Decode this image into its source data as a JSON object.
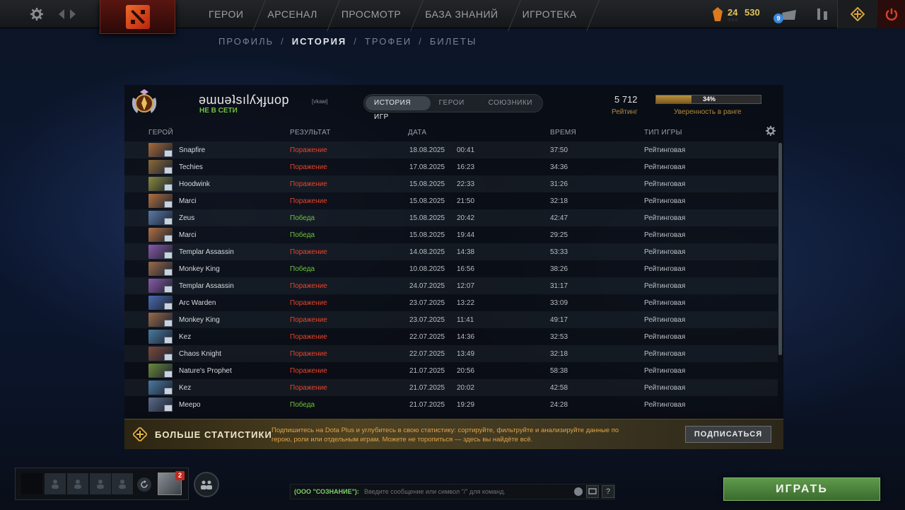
{
  "topbar": {
    "nav": [
      {
        "label": "ГЕРОИ"
      },
      {
        "label": "АРСЕНАЛ"
      },
      {
        "label": "ПРОСМОТР"
      },
      {
        "label": "БАЗА ЗНАНИЙ"
      },
      {
        "label": "ИГРОТЕКА"
      }
    ],
    "currency1": "24",
    "currency2": "530",
    "notifications": "9"
  },
  "subnav": {
    "items": [
      {
        "label": "ПРОФИЛЬ",
        "active": false
      },
      {
        "label": "ИСТОРИЯ",
        "active": true
      },
      {
        "label": "ТРОФЕИ",
        "active": false
      },
      {
        "label": "БИЛЕТЫ",
        "active": false
      }
    ]
  },
  "profile": {
    "name": "ǝɯuǝʇsılʎʞɟuop",
    "tag": "[vkaм]",
    "status": "НЕ В СЕТИ"
  },
  "tabs": [
    {
      "label": "ИСТОРИЯ ИГР",
      "active": true
    },
    {
      "label": "ГЕРОИ",
      "active": false
    },
    {
      "label": "СОЮЗНИКИ",
      "active": false
    }
  ],
  "rating": {
    "value": "5 712",
    "label": "Рейтинг",
    "confidence_percent": 34,
    "confidence_text": "34%",
    "confidence_label": "Уверенность в ранге"
  },
  "columns": {
    "hero": "ГЕРОЙ",
    "result": "РЕЗУЛЬТАТ",
    "date": "ДАТА",
    "duration": "ВРЕМЯ",
    "type": "ТИП ИГРЫ"
  },
  "matches": [
    {
      "hero": "Snapfire",
      "result": "Поражение",
      "win": false,
      "date": "18.08.2025",
      "time": "00:41",
      "duration": "37:50",
      "type": "Рейтинговая",
      "color": "#a86a38"
    },
    {
      "hero": "Techies",
      "result": "Поражение",
      "win": false,
      "date": "17.08.2025",
      "time": "16:23",
      "duration": "34:36",
      "type": "Рейтинговая",
      "color": "#8a6a3a"
    },
    {
      "hero": "Hoodwink",
      "result": "Поражение",
      "win": false,
      "date": "15.08.2025",
      "time": "22:33",
      "duration": "31:26",
      "type": "Рейтинговая",
      "color": "#8a8a3a"
    },
    {
      "hero": "Marci",
      "result": "Поражение",
      "win": false,
      "date": "15.08.2025",
      "time": "21:50",
      "duration": "32:18",
      "type": "Рейтинговая",
      "color": "#b07040"
    },
    {
      "hero": "Zeus",
      "result": "Победа",
      "win": true,
      "date": "15.08.2025",
      "time": "20:42",
      "duration": "42:47",
      "type": "Рейтинговая",
      "color": "#5a7aa8"
    },
    {
      "hero": "Marci",
      "result": "Победа",
      "win": true,
      "date": "15.08.2025",
      "time": "19:44",
      "duration": "29:25",
      "type": "Рейтинговая",
      "color": "#b07040"
    },
    {
      "hero": "Templar Assassin",
      "result": "Поражение",
      "win": false,
      "date": "14.08.2025",
      "time": "14:38",
      "duration": "53:33",
      "type": "Рейтинговая",
      "color": "#8a5aa8"
    },
    {
      "hero": "Monkey King",
      "result": "Победа",
      "win": true,
      "date": "10.08.2025",
      "time": "16:56",
      "duration": "38:26",
      "type": "Рейтинговая",
      "color": "#9a6a4a"
    },
    {
      "hero": "Templar Assassin",
      "result": "Поражение",
      "win": false,
      "date": "24.07.2025",
      "time": "12:07",
      "duration": "31:17",
      "type": "Рейтинговая",
      "color": "#8a5aa8"
    },
    {
      "hero": "Arc Warden",
      "result": "Поражение",
      "win": false,
      "date": "23.07.2025",
      "time": "13:22",
      "duration": "33:09",
      "type": "Рейтинговая",
      "color": "#4a6ab0"
    },
    {
      "hero": "Monkey King",
      "result": "Поражение",
      "win": false,
      "date": "23.07.2025",
      "time": "11:41",
      "duration": "49:17",
      "type": "Рейтинговая",
      "color": "#9a6a4a"
    },
    {
      "hero": "Kez",
      "result": "Поражение",
      "win": false,
      "date": "22.07.2025",
      "time": "14:36",
      "duration": "32:53",
      "type": "Рейтинговая",
      "color": "#4a7aa0"
    },
    {
      "hero": "Chaos Knight",
      "result": "Поражение",
      "win": false,
      "date": "22.07.2025",
      "time": "13:49",
      "duration": "32:18",
      "type": "Рейтинговая",
      "color": "#7a4a3a"
    },
    {
      "hero": "Nature's Prophet",
      "result": "Поражение",
      "win": false,
      "date": "21.07.2025",
      "time": "20:56",
      "duration": "58:38",
      "type": "Рейтинговая",
      "color": "#6a8a3a"
    },
    {
      "hero": "Kez",
      "result": "Поражение",
      "win": false,
      "date": "21.07.2025",
      "time": "20:02",
      "duration": "42:58",
      "type": "Рейтинговая",
      "color": "#4a7aa0"
    },
    {
      "hero": "Meepo",
      "result": "Победа",
      "win": true,
      "date": "21.07.2025",
      "time": "19:29",
      "duration": "24:28",
      "type": "Рейтинговая",
      "color": "#5a6a8a"
    }
  ],
  "plus": {
    "title": "БОЛЬШЕ СТАТИСТИКИ",
    "text": "Подпишитесь на Dota Plus и углубитесь в свою статистику: сортируйте, фильтруйте и анализируйте данные по герою, роли или отдельным играм. Можете не торопиться — здесь вы найдёте всё.",
    "button": "ПОДПИСАТЬСЯ"
  },
  "party": {
    "invite_count": "2"
  },
  "chat": {
    "channel": "(ООО \"СОЗНАНИЕ\"):",
    "placeholder": "Введите сообщение или символ \"/\" для команд."
  },
  "play": {
    "label": "ИГРАТЬ"
  },
  "colors": {
    "loss": "#e8432b",
    "win": "#6fc23b",
    "accent": "#b28a3c"
  }
}
